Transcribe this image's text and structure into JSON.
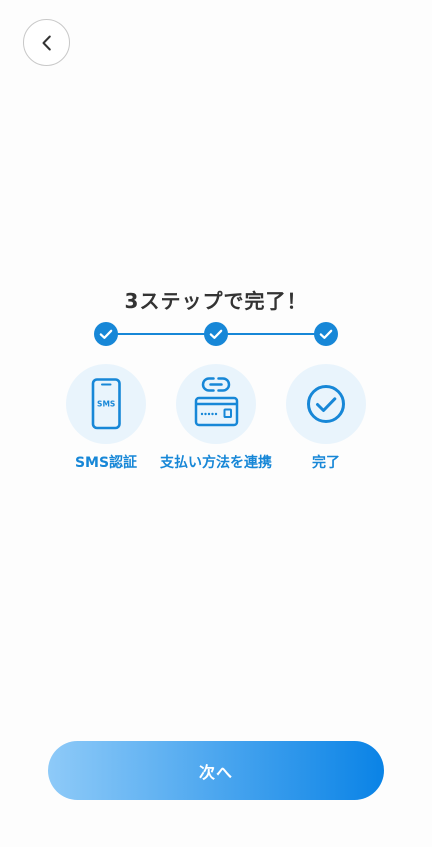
{
  "header": {
    "back_button": {
      "icon": "chevron-left-icon"
    }
  },
  "title": "3ステップで完了！",
  "progress": {
    "completed_steps": 3,
    "step_icon": "check-icon"
  },
  "steps": [
    {
      "label": "SMS認証",
      "icon": "smartphone-sms-icon",
      "icon_text": "SMS",
      "completed": true
    },
    {
      "label": "支払い方法を連携",
      "icon": "link-credit-card-icon",
      "completed": true
    },
    {
      "label": "完了",
      "icon": "check-circle-icon",
      "completed": true
    }
  ],
  "next_button": {
    "label": "次へ"
  },
  "colors": {
    "accent": "#1787d7",
    "icon_background": "#e9f4fc",
    "title": "#333333",
    "button_gradient_start": "#8ecaf8",
    "button_gradient_end": "#0a83e6",
    "button_text": "#ffffff",
    "back_border": "#c8c8c8",
    "background": "#fdfdfd"
  }
}
